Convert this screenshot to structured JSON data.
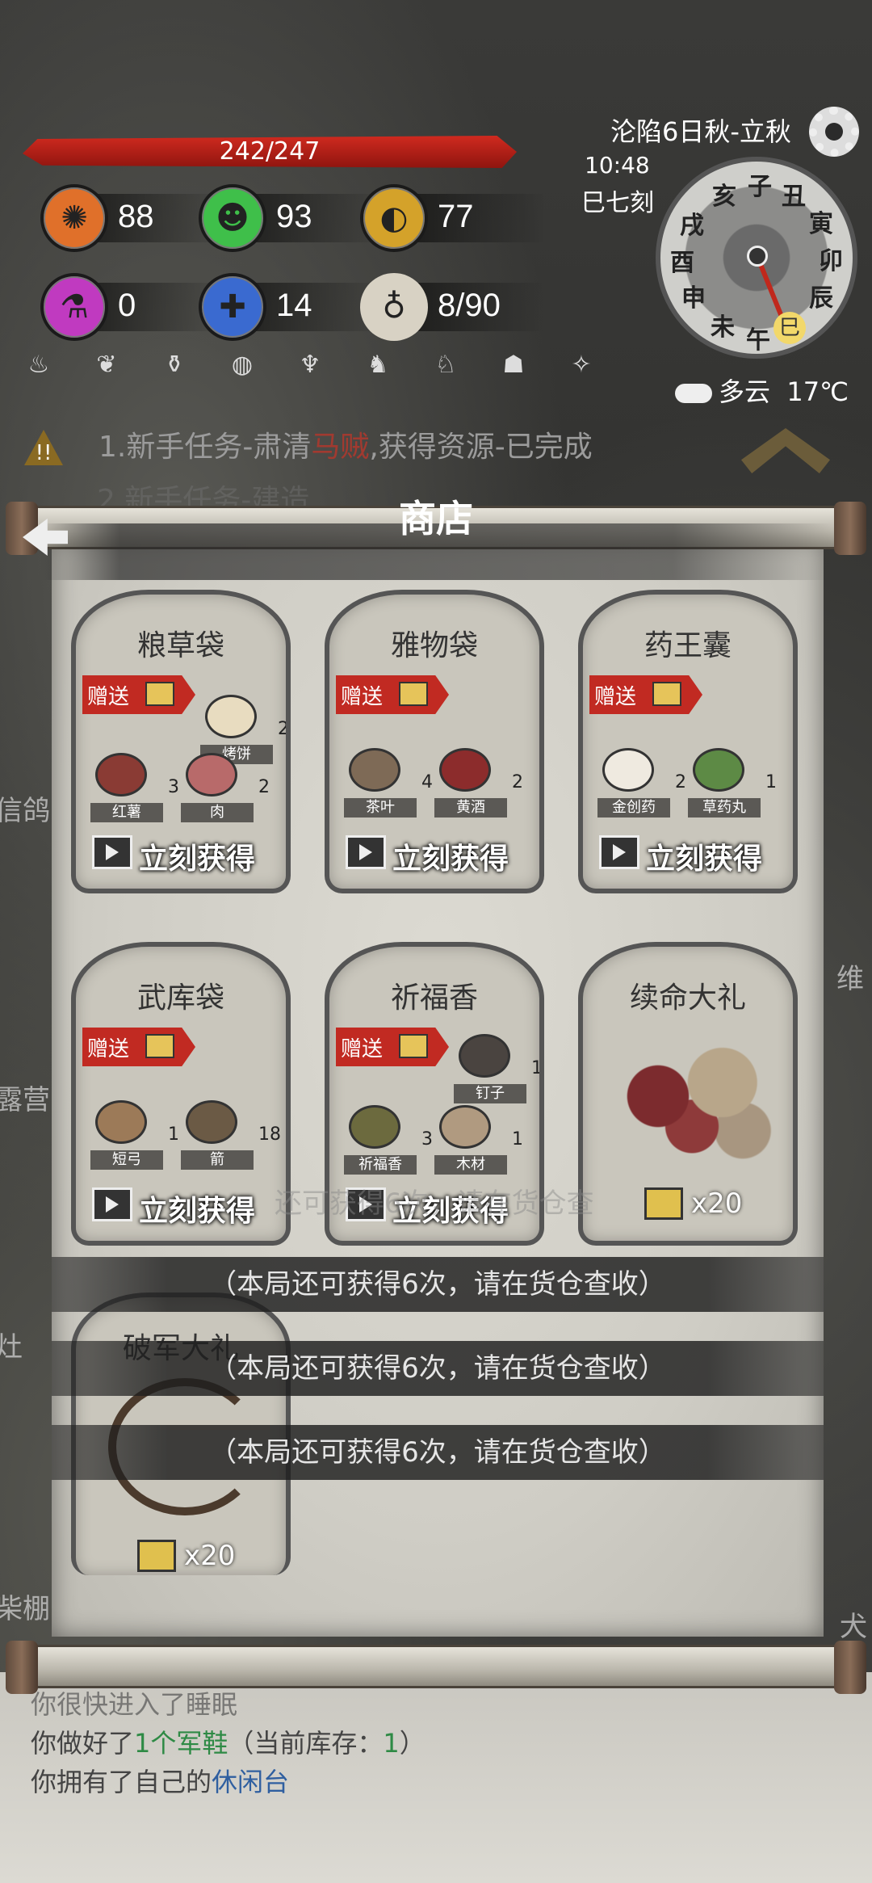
{
  "hud": {
    "hp": "242/247",
    "stats": [
      {
        "name": "brain-icon",
        "value": "88",
        "color": "#e0702a"
      },
      {
        "name": "smile-icon",
        "value": "93",
        "color": "#3fbf4a"
      },
      {
        "name": "stomach-icon",
        "value": "77",
        "color": "#d4a22a"
      },
      {
        "name": "potion-icon",
        "value": "0",
        "color": "#c03ac0"
      },
      {
        "name": "bandage-icon",
        "value": "14",
        "color": "#3a6ad0"
      },
      {
        "name": "bag-icon",
        "value": "8/90",
        "color": "#d8d2c4"
      }
    ],
    "mini_icons": [
      "cauldron-icon",
      "gourds-icon",
      "vase-icon",
      "plate-icon",
      "oil-lamp-icon",
      "boots-icon",
      "horse-icon",
      "sack-icon",
      "torch-icon"
    ]
  },
  "clock": {
    "season": "沦陷6日秋-立秋",
    "time": "10:48",
    "shichen": "巳七刻",
    "dial_glyphs": [
      "亥",
      "子",
      "丑",
      "寅",
      "卯",
      "辰",
      "巳",
      "午",
      "未",
      "申",
      "酉",
      "戌"
    ],
    "weather": "多云",
    "temp": "17℃"
  },
  "quest": {
    "prefix": "1.新手任务-肃清",
    "highlight": "马贼",
    "suffix": ",获得资源-已完成",
    "warn_glyph": "!!",
    "second_line": "2.新手任务-建造"
  },
  "shop": {
    "title": "商店",
    "gift_label": "赠送",
    "get_label": "立刻获得",
    "cards": [
      {
        "name": "粮草袋",
        "items": [
          {
            "label": "烤饼",
            "qty": "2"
          },
          {
            "label": "红薯",
            "qty": "3"
          },
          {
            "label": "肉",
            "qty": "2"
          }
        ]
      },
      {
        "name": "雅物袋",
        "items": [
          {
            "label": "茶叶",
            "qty": "4"
          },
          {
            "label": "黄酒",
            "qty": "2"
          }
        ]
      },
      {
        "name": "药王囊",
        "items": [
          {
            "label": "金创药",
            "qty": "2"
          },
          {
            "label": "草药丸",
            "qty": "1"
          }
        ]
      },
      {
        "name": "武库袋",
        "items": [
          {
            "label": "短弓",
            "qty": "1"
          },
          {
            "label": "箭",
            "qty": "18"
          }
        ]
      },
      {
        "name": "祈福香",
        "items": [
          {
            "label": "钉子",
            "qty": "1"
          },
          {
            "label": "祈福香",
            "qty": "3"
          },
          {
            "label": "木材",
            "qty": "1"
          }
        ]
      },
      {
        "name": "续命大礼",
        "cost": "x20"
      },
      {
        "name": "破军大礼",
        "cost": "x20"
      }
    ]
  },
  "toasts": [
    "（本局还可获得6次，请在货仓查收）",
    "（本局还可获得6次，请在货仓查收）",
    "（本局还可获得6次，请在货仓查收）"
  ],
  "toast_ghost": "还可获得6次，请在货仓查",
  "background_labels": [
    "信鸽",
    "露营",
    "灶",
    "柴棚",
    "犬",
    "维"
  ],
  "log": {
    "line0": "你很快进入了睡眠",
    "line1_a": "你做好了",
    "line1_num": "1",
    "line1_item": "个军鞋",
    "line1_b": "（当前库存：",
    "line1_stock": "1",
    "line1_c": "）",
    "line2_a": "你拥有了自己的",
    "line2_item": "休闲台"
  }
}
